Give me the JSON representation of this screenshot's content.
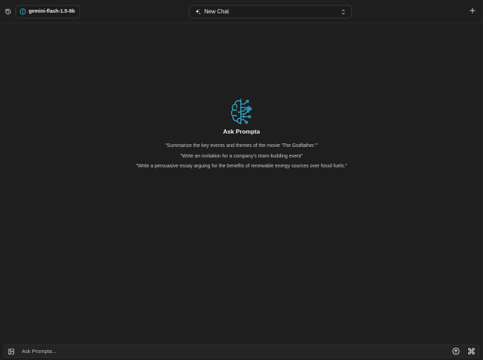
{
  "header": {
    "history_icon": "history-clock-icon",
    "model": {
      "icon": "model-info-icon",
      "label": "gemini-flash-1.5-8b"
    },
    "chat_selector": {
      "icon": "sparkle-icon",
      "label": "New Chat",
      "chevron_icon": "chevron-up-down-icon"
    },
    "new_chat_icon": "plus-icon"
  },
  "hero": {
    "logo_icon": "brain-circuit-icon",
    "title": "Ask Prompta",
    "suggestions": [
      "\"Summarize the key events and themes of the movie 'The Godfather.'\"",
      "\"Write an invitation for a company's team-building event\"",
      "\"Write a persuasive essay arguing for the benefits of renewable energy sources over fossil fuels.\""
    ]
  },
  "composer": {
    "image_icon": "image-upload-icon",
    "placeholder": "Ask Prompta...",
    "value": "",
    "send_icon": "send-arrow-up-icon",
    "shortcut_icon": "command-key-icon"
  },
  "colors": {
    "background": "#1e1e1e",
    "accent": "#2fb3d4",
    "text": "#f2f2f2"
  }
}
